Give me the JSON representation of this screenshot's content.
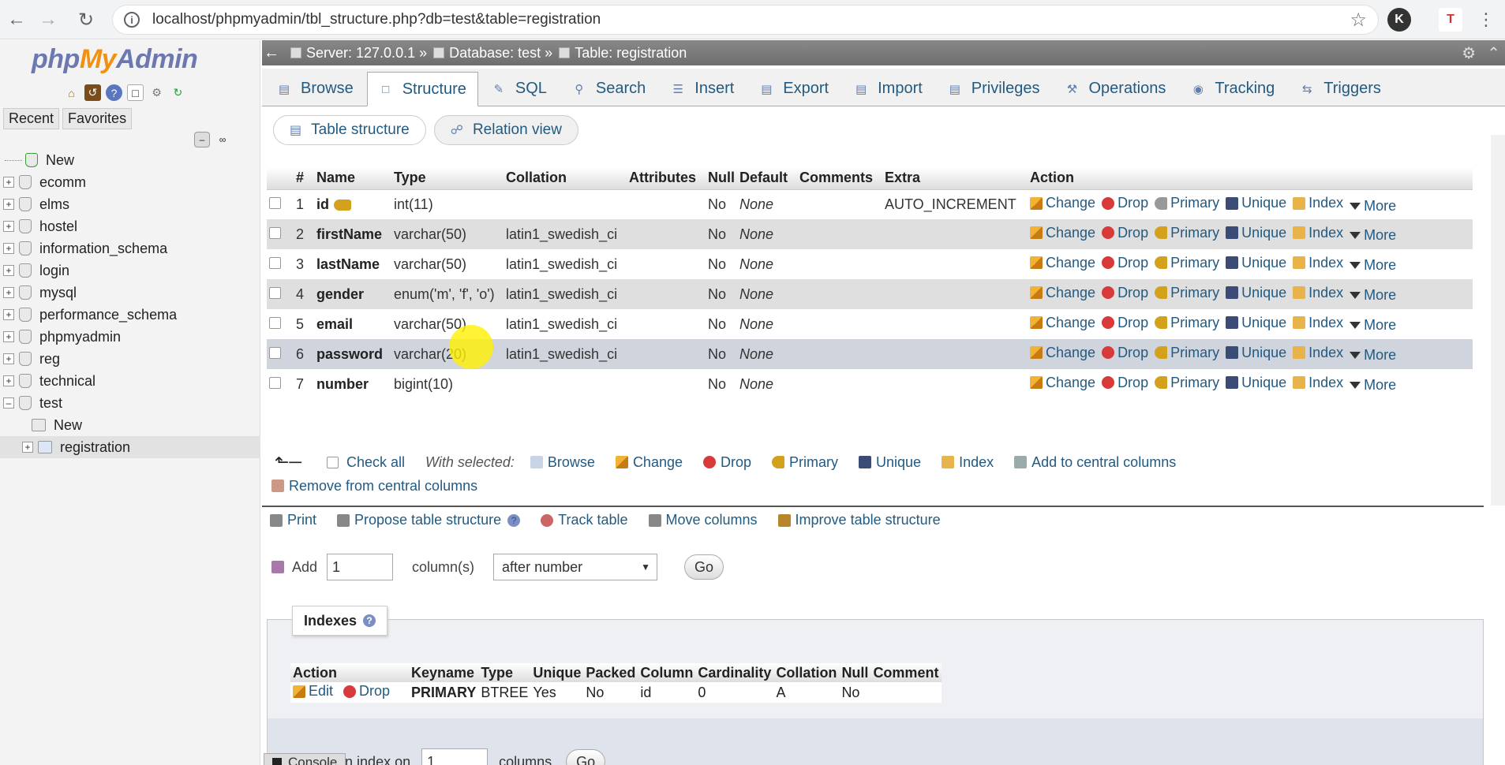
{
  "browser": {
    "url": "localhost/phpmyadmin/tbl_structure.php?db=test&table=registration"
  },
  "logo": {
    "php": "php",
    "my": "My",
    "admin": "Admin"
  },
  "nav": {
    "recent": "Recent",
    "favorites": "Favorites",
    "tree": [
      "New",
      "ecomm",
      "elms",
      "hostel",
      "information_schema",
      "login",
      "mysql",
      "performance_schema",
      "phpmyadmin",
      "reg",
      "technical",
      "test"
    ],
    "test_children": [
      "New",
      "registration"
    ]
  },
  "breadcrumb": {
    "server": "Server: 127.0.0.1 »",
    "database": "Database: test »",
    "table": "Table: registration"
  },
  "tabs": [
    "Browse",
    "Structure",
    "SQL",
    "Search",
    "Insert",
    "Export",
    "Import",
    "Privileges",
    "Operations",
    "Tracking",
    "Triggers"
  ],
  "subtabs": {
    "table_structure": "Table structure",
    "relation_view": "Relation view"
  },
  "columns": [
    "#",
    "Name",
    "Type",
    "Collation",
    "Attributes",
    "Null",
    "Default",
    "Comments",
    "Extra",
    "Action"
  ],
  "rows": [
    {
      "num": "1",
      "name": "id",
      "type": "int(11)",
      "collation": "",
      "null": "No",
      "default": "None",
      "extra": "AUTO_INCREMENT"
    },
    {
      "num": "2",
      "name": "firstName",
      "type": "varchar(50)",
      "collation": "latin1_swedish_ci",
      "null": "No",
      "default": "None",
      "extra": ""
    },
    {
      "num": "3",
      "name": "lastName",
      "type": "varchar(50)",
      "collation": "latin1_swedish_ci",
      "null": "No",
      "default": "None",
      "extra": ""
    },
    {
      "num": "4",
      "name": "gender",
      "type": "enum('m', 'f', 'o')",
      "collation": "latin1_swedish_ci",
      "null": "No",
      "default": "None",
      "extra": ""
    },
    {
      "num": "5",
      "name": "email",
      "type": "varchar(50)",
      "collation": "latin1_swedish_ci",
      "null": "No",
      "default": "None",
      "extra": ""
    },
    {
      "num": "6",
      "name": "password",
      "type": "varchar(20)",
      "collation": "latin1_swedish_ci",
      "null": "No",
      "default": "None",
      "extra": ""
    },
    {
      "num": "7",
      "name": "number",
      "type": "bigint(10)",
      "collation": "",
      "null": "No",
      "default": "None",
      "extra": ""
    }
  ],
  "row_actions": {
    "change": "Change",
    "drop": "Drop",
    "primary": "Primary",
    "unique": "Unique",
    "index": "Index",
    "more": "More"
  },
  "with_selected": {
    "check_all": "Check all",
    "label": "With selected:",
    "browse": "Browse",
    "change": "Change",
    "drop": "Drop",
    "primary": "Primary",
    "unique": "Unique",
    "index": "Index",
    "add_central": "Add to central columns",
    "remove_central": "Remove from central columns"
  },
  "tools": {
    "print": "Print",
    "propose": "Propose table structure",
    "track": "Track table",
    "move": "Move columns",
    "improve": "Improve table structure"
  },
  "add_columns": {
    "label": "Add",
    "value": "1",
    "unit": "column(s)",
    "position": "after number",
    "go": "Go"
  },
  "indexes": {
    "legend": "Indexes",
    "columns": [
      "Action",
      "Keyname",
      "Type",
      "Unique",
      "Packed",
      "Column",
      "Cardinality",
      "Collation",
      "Null",
      "Comment"
    ],
    "row": {
      "edit": "Edit",
      "drop": "Drop",
      "keyname": "PRIMARY",
      "type": "BTREE",
      "unique": "Yes",
      "packed": "No",
      "column": "id",
      "cardinality": "0",
      "collation": "A",
      "null": "No",
      "comment": ""
    },
    "create_label": "Create an index on",
    "create_value": "1",
    "create_unit": "columns",
    "go": "Go"
  },
  "console": "Console"
}
